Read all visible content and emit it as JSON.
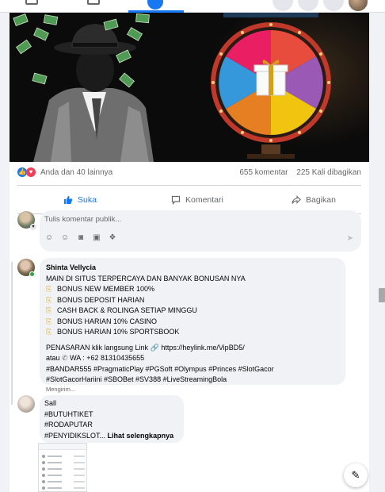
{
  "post": {
    "reactions_text": "Anda dan 40 lainnya",
    "comments_count": "655 komentar",
    "shares_count": "225 Kali dibagikan",
    "actions": {
      "like": "Suka",
      "comment": "Komentari",
      "share": "Bagikan"
    }
  },
  "composer": {
    "placeholder": "Tulis komentar publik..."
  },
  "comments": [
    {
      "author": "Shinta Vellycia",
      "intro": "MAIN DI SITUS TERPERCAYA DAN BANYAK BONUSAN NYA",
      "bonuses": [
        "BONUS NEW MEMBER 100%",
        "BONUS DEPOSIT HARIAN",
        "CASH BACK & ROLINGA SETIAP MINGGU",
        "BONUS HARIAN 10% CASINO",
        "BONUS HARIAN 10% SPORTSBOOK"
      ],
      "link_prefix": "PENASARAN klik langsung Link",
      "link_url": "https://heylink.me/VipBD5/",
      "wa_prefix": "atau",
      "wa_text": "WA : +62 81310435655",
      "hashtags_1": "#BANDAR555 #PragmaticPlay #PGSoft #Olympus #Princes #SlotGacor",
      "hashtags_2": "#SlotGacorHariini #SBOBet #SV388 #LiveStreamingBola",
      "status": "Mengirim..."
    },
    {
      "author": "Sall",
      "line1": "#BUTUHTIKET",
      "line2": "#RODAPUTAR",
      "line3": "#PENYIDIKSLOT...",
      "see_more": "Lihat selengkapnya"
    }
  ]
}
